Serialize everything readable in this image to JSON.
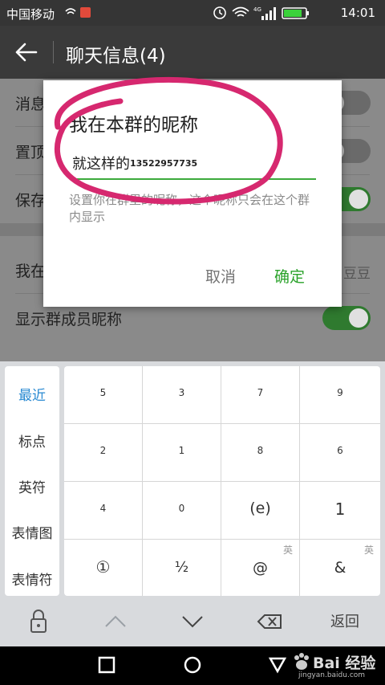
{
  "status_bar": {
    "carrier": "中国移动",
    "network": "4G",
    "time": "14:01"
  },
  "toolbar": {
    "title": "聊天信息(4)"
  },
  "settings": {
    "rows": [
      {
        "label": "消息免打扰",
        "toggle": "off"
      },
      {
        "label": "置顶聊天",
        "toggle": "off"
      },
      {
        "label": "保存到通讯录",
        "toggle": "on"
      },
      {
        "label": "我在本群的昵称",
        "value": "豆豆"
      },
      {
        "label": "显示群成员昵称",
        "toggle": "on"
      }
    ]
  },
  "dialog": {
    "title": "我在本群的昵称",
    "input_value": "就这样的",
    "input_suffix": "13522957735",
    "hint": "设置你在群里的昵称，这个昵称只会在这个群内显示",
    "cancel_label": "取消",
    "ok_label": "确定"
  },
  "keyboard": {
    "categories": [
      "最近",
      "标点",
      "英符",
      "表情图",
      "表情符"
    ],
    "keys": [
      [
        "5",
        "3",
        "7",
        "9"
      ],
      [
        "2",
        "1",
        "8",
        "6"
      ],
      [
        "4",
        "0",
        "(e)",
        "1"
      ],
      [
        "①",
        "½",
        "@",
        "&"
      ]
    ],
    "key_superscript": "英",
    "back_label": "返回"
  },
  "watermark": {
    "brand": "Bai 经验",
    "url": "jingyan.baidu.com"
  },
  "colors": {
    "accent_green": "#2aa22a",
    "highlight_circle": "#d6286f",
    "toolbar_bg": "#3a3a3a"
  }
}
